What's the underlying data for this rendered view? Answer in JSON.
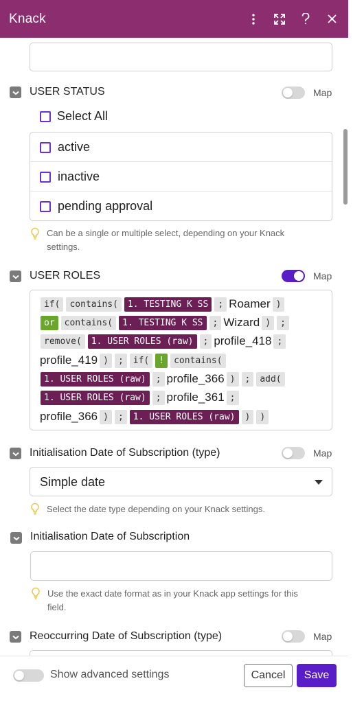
{
  "header": {
    "title": "Knack"
  },
  "user_status": {
    "label": "USER STATUS",
    "map_label": "Map",
    "select_all": "Select All",
    "options": [
      {
        "label": "active"
      },
      {
        "label": "inactive"
      },
      {
        "label": "pending approval"
      }
    ],
    "hint": [
      "Can be a single or multiple select, depending on your Knack",
      "settings."
    ]
  },
  "user_roles": {
    "label": "USER ROLES",
    "map_label": "Map",
    "formula": {
      "if1": "if(",
      "contains1": "contains(",
      "testing1": "1. TESTING K SS",
      "semi": ";",
      "roamer": "Roamer",
      "close": ")",
      "or": "or",
      "contains2": "contains(",
      "testing2": "1. TESTING K SS",
      "wizard": "Wizard",
      "remove": "remove(",
      "roles_raw": "1. USER ROLES (raw)",
      "profile_418": "profile_418",
      "profile_419": "profile_419",
      "if2": "if(",
      "not": "!",
      "contains3": "contains(",
      "profile_366": "profile_366",
      "add": "add(",
      "profile_361": "profile_361"
    }
  },
  "init_date_type": {
    "label": "Initialisation Date of Subscription (type)",
    "map_label": "Map",
    "selected": "Simple date",
    "hint": "Select the date type depending on your Knack settings."
  },
  "init_date": {
    "label": "Initialisation Date of Subscription",
    "value": "",
    "hint": [
      "Use the exact date format as in your Knack app settings for this",
      "field."
    ]
  },
  "reoccur_date_type": {
    "label": "Reoccurring Date of Subscription (type)",
    "map_label": "Map"
  },
  "footer": {
    "advanced": "Show advanced settings",
    "cancel": "Cancel",
    "save": "Save"
  },
  "colors": {
    "header": "#8b2d6e",
    "accent": "#5a1ec8",
    "pill_purple": "#6b1f55",
    "pill_green": "#6aa62c"
  }
}
